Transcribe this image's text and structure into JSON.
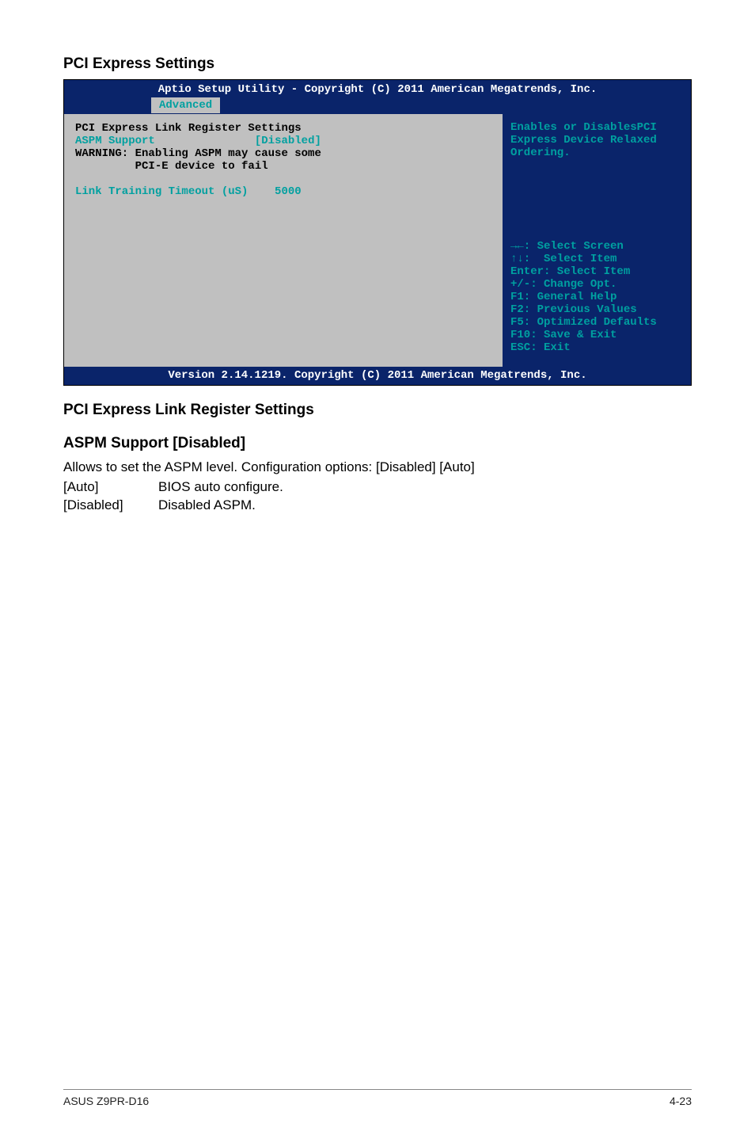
{
  "headings": {
    "pci_express_settings": "PCI Express Settings",
    "link_register": "PCI Express Link Register Settings",
    "aspm_support": "ASPM Support [Disabled]"
  },
  "bios": {
    "header": "Aptio Setup Utility - Copyright (C) 2011 American Megatrends, Inc.",
    "tab": "Advanced",
    "left": {
      "title": "PCI Express Link Register Settings",
      "aspm_label": "ASPM Support",
      "aspm_value": "[Disabled]",
      "warning1": "WARNING: Enabling ASPM may cause some",
      "warning2": "         PCI-E device to fail",
      "link_training_label": "Link Training Timeout (uS)",
      "link_training_value": "5000"
    },
    "right": {
      "help1": "Enables or DisablesPCI",
      "help2": "Express Device Relaxed",
      "help3": "Ordering.",
      "nav1": "→←: Select Screen",
      "nav2": "↑↓:  Select Item",
      "nav3": "Enter: Select Item",
      "nav4": "+/-: Change Opt.",
      "nav5": "F1: General Help",
      "nav6": "F2: Previous Values",
      "nav7": "F5: Optimized Defaults",
      "nav8": "F10: Save & Exit",
      "nav9": "ESC: Exit"
    },
    "footer": "Version 2.14.1219. Copyright (C) 2011 American Megatrends, Inc."
  },
  "body": {
    "desc": "Allows to set the ASPM level. Configuration options: [Disabled] [Auto]",
    "opt_auto_label": "[Auto]",
    "opt_auto_desc": "BIOS auto configure.",
    "opt_disabled_label": "[Disabled]",
    "opt_disabled_desc": "Disabled ASPM."
  },
  "footer": {
    "left": "ASUS Z9PR-D16",
    "right": "4-23"
  }
}
